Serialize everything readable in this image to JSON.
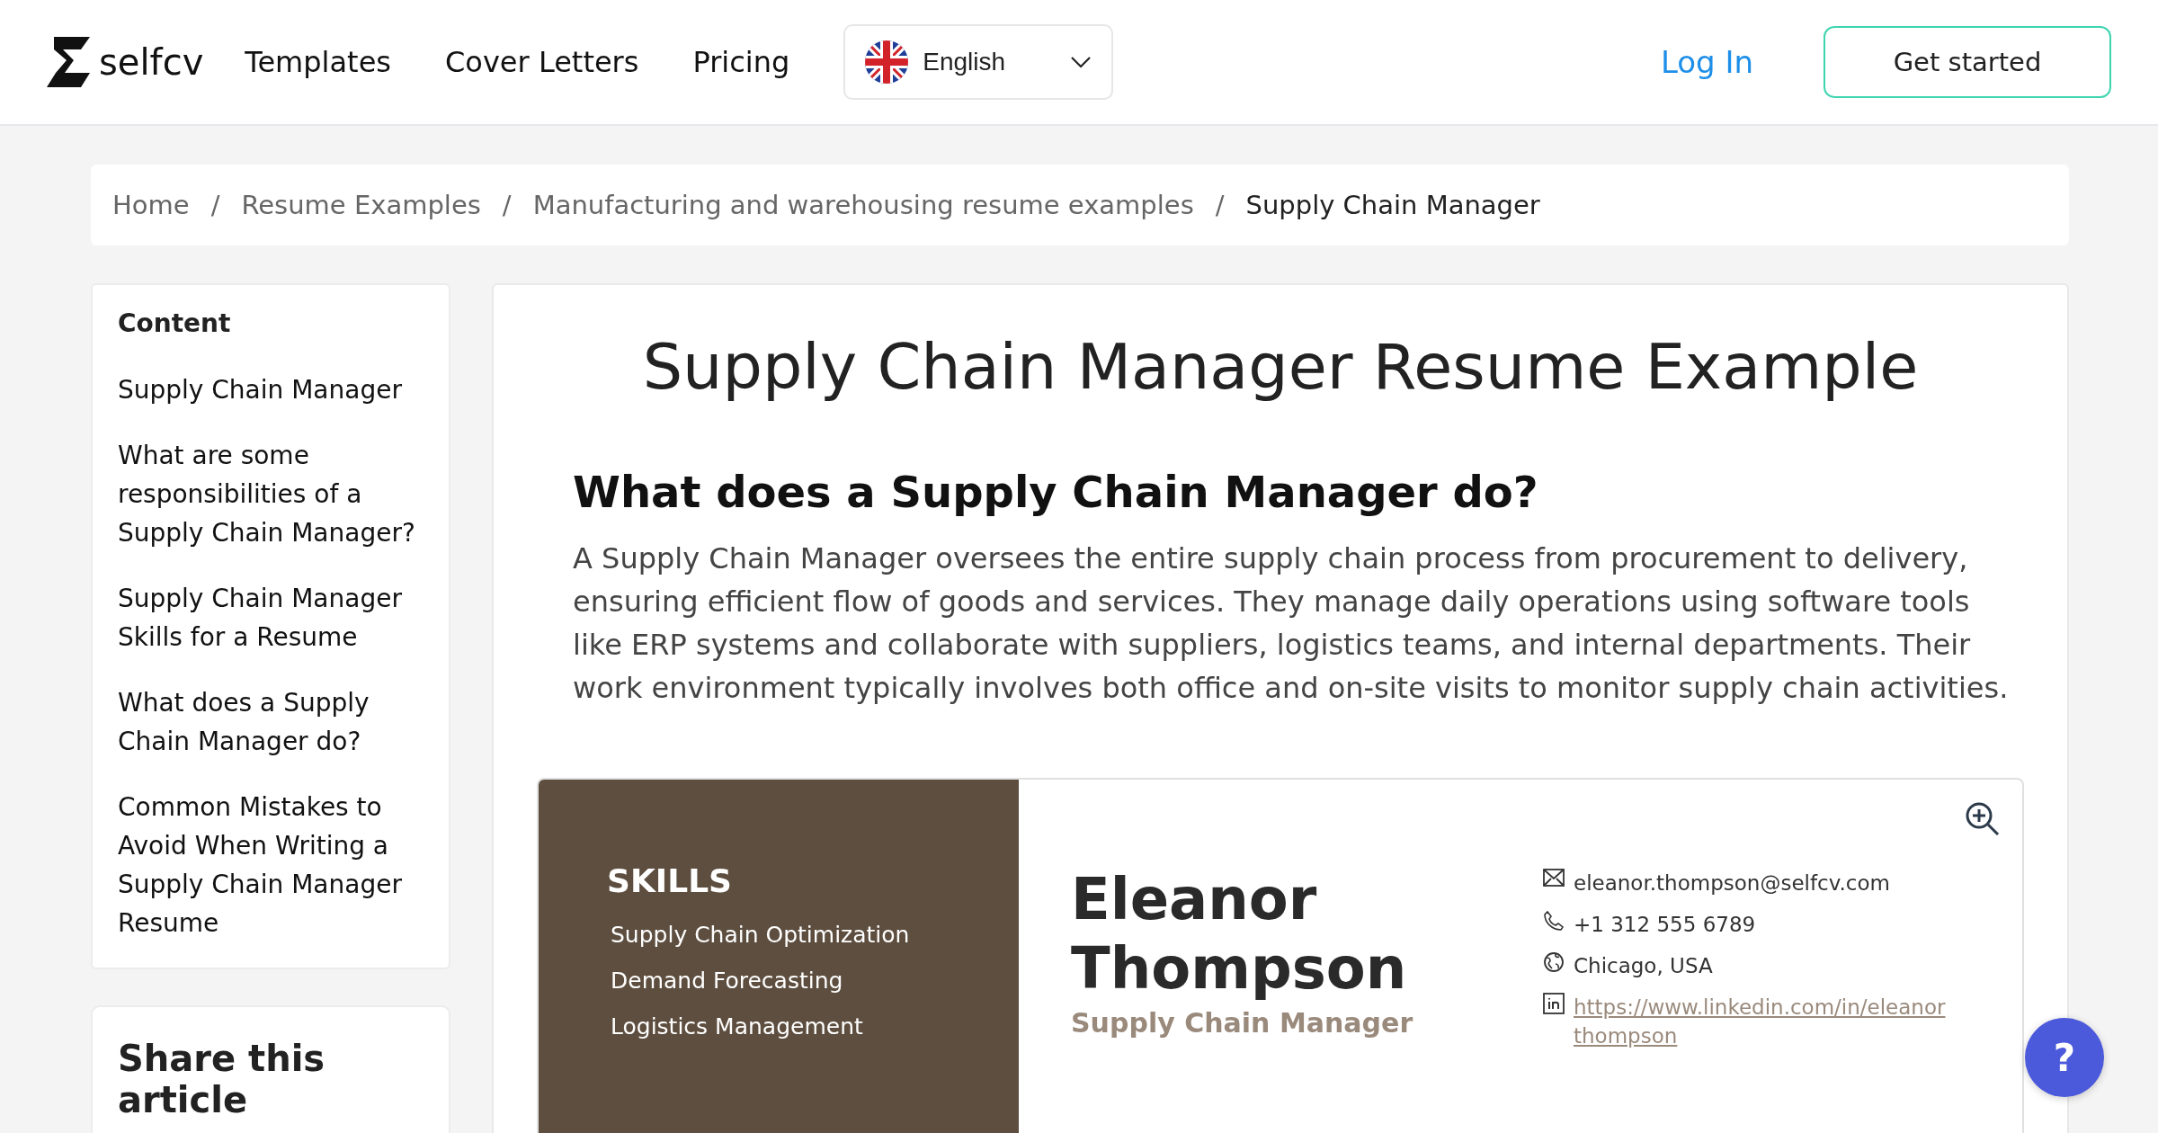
{
  "header": {
    "logo": "selfcv",
    "nav": [
      "Templates",
      "Cover Letters",
      "Pricing"
    ],
    "language": "English",
    "login": "Log In",
    "cta": "Get started"
  },
  "breadcrumb": [
    {
      "label": "Home",
      "current": false
    },
    {
      "label": "Resume Examples",
      "current": false
    },
    {
      "label": "Manufacturing and warehousing resume examples",
      "current": false
    },
    {
      "label": "Supply Chain Manager",
      "current": true
    }
  ],
  "breadcrumb_separator": "/",
  "sidebar": {
    "title": "Content",
    "items": [
      "Supply Chain Manager",
      "What are some responsibilities of a Supply Chain Manager?",
      "Supply Chain Manager Skills for a Resume",
      "What does a Supply Chain Manager do?",
      "Common Mistakes to Avoid When Writing a Supply Chain Manager Resume"
    ]
  },
  "share": {
    "title": "Share this article"
  },
  "article": {
    "title": "Supply Chain Manager Resume Example",
    "heading": "What does a Supply Chain Manager do?",
    "paragraph": "A Supply Chain Manager oversees the entire supply chain process from procurement to delivery, ensuring efficient flow of goods and services. They manage daily operations using software tools like ERP systems and collaborate with suppliers, logistics teams, and internal departments. Their work environment typically involves both office and on-site visits to monitor supply chain activities."
  },
  "resume": {
    "skills_title": "SKILLS",
    "skills": [
      "Supply Chain Optimization",
      "Demand Forecasting",
      "Logistics Management"
    ],
    "first_name": "Eleanor",
    "last_name": "Thompson",
    "role": "Supply Chain Manager",
    "contacts": [
      {
        "kind": "email",
        "text": "eleanor.thompson@selfcv.com"
      },
      {
        "kind": "phone",
        "text": "+1 312 555 6789"
      },
      {
        "kind": "location",
        "text": "Chicago, USA"
      },
      {
        "kind": "linkedin",
        "text": "https://www.linkedin.com/in/eleanor thompson"
      }
    ]
  },
  "help": {
    "label": "?"
  }
}
